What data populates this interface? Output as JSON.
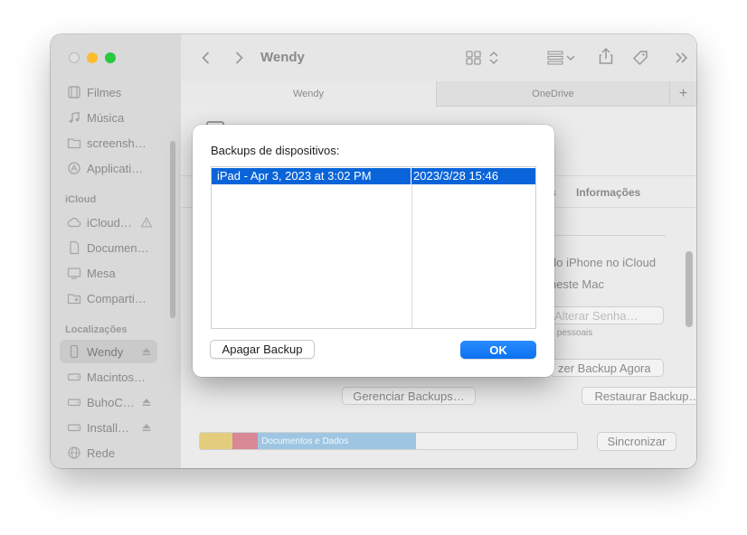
{
  "window": {
    "title": "Wendy",
    "tabs": [
      "Wendy",
      "OneDrive"
    ],
    "add_tab": "+"
  },
  "sidebar": {
    "top_items": [
      {
        "label": "Filmes",
        "icon": "film-icon"
      },
      {
        "label": "Música",
        "icon": "music-note-icon"
      },
      {
        "label": "screensh…",
        "icon": "folder-icon"
      },
      {
        "label": "Applicati…",
        "icon": "applications-icon"
      }
    ],
    "icloud_header": "iCloud",
    "icloud_items": [
      {
        "label": "iCloud…",
        "icon": "cloud-icon"
      },
      {
        "label": "Documen…",
        "icon": "document-icon"
      },
      {
        "label": "Mesa",
        "icon": "desktop-icon"
      },
      {
        "label": "Comparti…",
        "icon": "shared-folder-icon"
      }
    ],
    "locations_header": "Localizações",
    "location_items": [
      {
        "label": "Wendy",
        "icon": "phone-icon"
      },
      {
        "label": "Macintos…",
        "icon": "disk-icon"
      },
      {
        "label": "BuhoC…",
        "icon": "disk-icon"
      },
      {
        "label": "Install…",
        "icon": "disk-icon"
      },
      {
        "label": "Rede",
        "icon": "globe-icon"
      }
    ]
  },
  "content": {
    "subtab_fragment": "s",
    "subtab_info": "Informações",
    "line_icloud": "do iPhone no iCloud",
    "line_mac": "neste Mac",
    "btn_change_password": "Alterar Senha…",
    "personal_note": "s pessoais",
    "btn_backup_now": "zer Backup Agora",
    "btn_manage_backups": "Gerenciar Backups…",
    "btn_restore_backup": "Restaurar Backup…",
    "storage_label": "Documentos e Dados",
    "btn_sync": "Sincronizar"
  },
  "storage_bar": {
    "segments": [
      {
        "name": "yellow",
        "fraction": 0.087,
        "color": "#e3cc7c"
      },
      {
        "name": "pink",
        "fraction": 0.067,
        "color": "#d98896"
      },
      {
        "name": "documents",
        "fraction": 0.42,
        "color": "#9ec6e2"
      }
    ]
  },
  "modal": {
    "title": "Backups de dispositivos:",
    "rows": [
      {
        "name": "iPad - Apr 3, 2023 at 3:02 PM",
        "date": "2023/3/28 15:46"
      }
    ],
    "delete_button": "Apagar Backup",
    "ok_button": "OK",
    "accent_color": "#0a64d9"
  }
}
